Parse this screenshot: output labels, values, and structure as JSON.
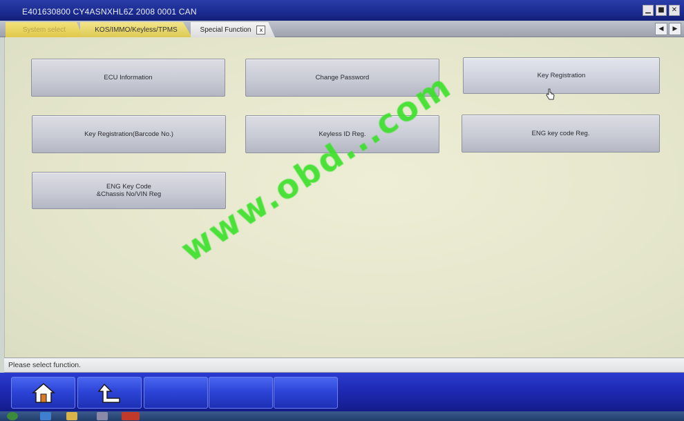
{
  "window": {
    "title": "E401630800   CY4ASNXHL6Z 2008    0001 CAN",
    "controls": {
      "minimize": "▁",
      "maximize": "■",
      "close": "✕"
    }
  },
  "tabs": [
    {
      "label": "System select"
    },
    {
      "label": "KOS/IMMO/Keyless/TPMS"
    },
    {
      "label": "Special Function",
      "close": "x"
    }
  ],
  "nav": {
    "prev": "◀",
    "next": "▶"
  },
  "functions": {
    "ecu_information": "ECU Information",
    "change_password": "Change Password",
    "key_registration": "Key Registration",
    "key_registration_barcode": "Key Registration(Barcode No.)",
    "keyless_id_reg": "Keyless ID Reg.",
    "eng_key_code_reg": "ENG key code Reg.",
    "eng_key_code_chassis": "ENG Key Code\n&Chassis No/VIN Reg"
  },
  "watermark": "www.obd...com",
  "status": {
    "message": "Please select function."
  },
  "toolbar": {
    "home": "home-icon",
    "back": "back-arrow-icon"
  },
  "colors": {
    "titlebar": "#1a2a90",
    "toolbar": "#1c28b0",
    "watermark": "#38e028",
    "panel": "#e5e6cc"
  }
}
